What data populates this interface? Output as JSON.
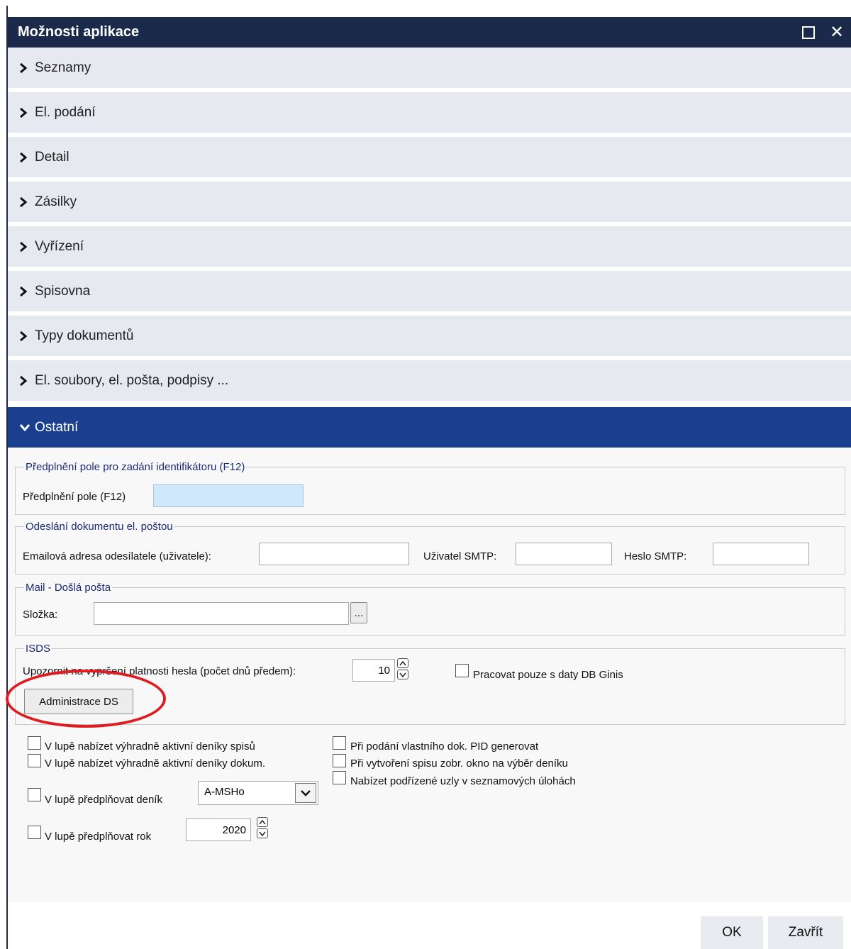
{
  "window": {
    "title": "Možnosti aplikace"
  },
  "sections": [
    {
      "label": "Seznamy"
    },
    {
      "label": "El. podání"
    },
    {
      "label": "Detail"
    },
    {
      "label": "Zásilky"
    },
    {
      "label": "Vyřízení"
    },
    {
      "label": "Spisovna"
    },
    {
      "label": "Typy dokumentů"
    },
    {
      "label": "El. soubory, el. pošta, podpisy ..."
    }
  ],
  "open_section": {
    "label": "Ostatní"
  },
  "prefill": {
    "legend": "Předplnění pole pro zadání identifikátoru (F12)",
    "label": "Předplnění pole (F12)",
    "value": ""
  },
  "email": {
    "legend": "Odeslání dokumentu el. poštou",
    "sender_label": "Emailová adresa odesílatele (uživatele):",
    "sender_value": "",
    "smtp_user_label": "Uživatel SMTP:",
    "smtp_user_value": "",
    "smtp_pass_label": "Heslo SMTP:",
    "smtp_pass_value": ""
  },
  "mail_in": {
    "legend": "Mail - Došlá pošta",
    "folder_label": "Složka:",
    "folder_value": "",
    "browse_label": "..."
  },
  "isds": {
    "legend": "ISDS",
    "expiry_label": "Upozornit na vypršení platnosti hesla (počet dnů předem):",
    "expiry_value": "10",
    "db_only_label": "Pracovat pouze s daty DB Ginis",
    "admin_button": "Administrace DS"
  },
  "options": {
    "active_spisy": "V lupě nabízet výhradně aktivní deníky spisů",
    "active_dokum": "V lupě nabízet výhradně aktivní deníky dokum.",
    "prefill_denik": "V lupě předplňovat deník",
    "denik_value": "A-MSHo",
    "prefill_rok": "V lupě předplňovat rok",
    "rok_value": "2020",
    "pid_generate": "Při podání vlastního dok. PID generovat",
    "spis_window": "Při vytvoření spisu zobr. okno na výběr deníku",
    "subnodes": "Nabízet podřízené uzly v seznamových úlohách"
  },
  "footer": {
    "ok": "OK",
    "close": "Zavřít"
  },
  "colors": {
    "titlebar": "#1b2a4a",
    "section_bg": "#e7e9f0",
    "open_section_bg": "#1b3f8f",
    "legend_text": "#1a2b7a",
    "annotation_ring": "#e11b22"
  }
}
